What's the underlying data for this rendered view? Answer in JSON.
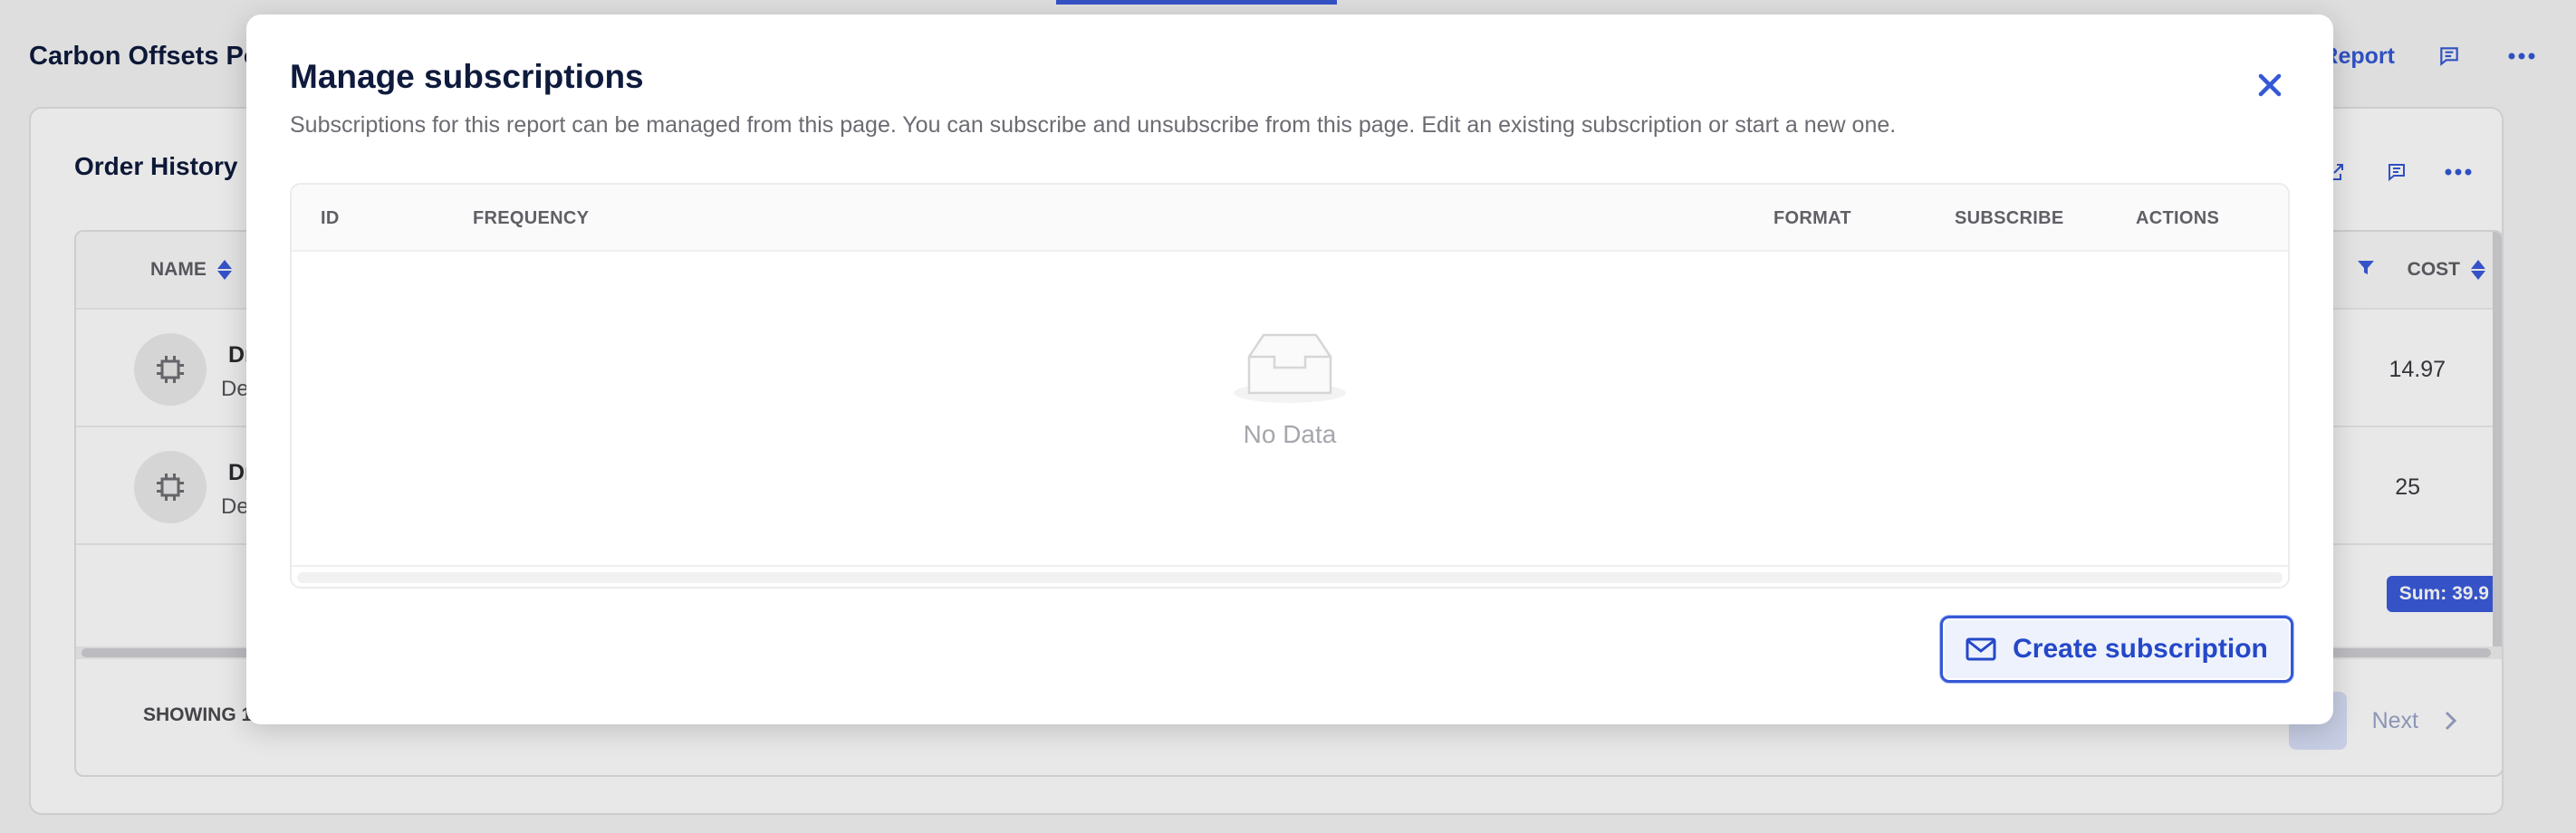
{
  "page": {
    "title": "Carbon Offsets Po",
    "header_link_label": "d Report",
    "card_title": "Order History",
    "columns": {
      "name": "NAME",
      "cost": "COST"
    },
    "rows": [
      {
        "name": "Dr",
        "desc": "De",
        "cost": "14.97"
      },
      {
        "name": "Dr",
        "desc": "De",
        "cost": "25"
      }
    ],
    "sum_badge": "Sum: 39.9",
    "showing": "SHOWING 1",
    "pager": {
      "next": "Next"
    }
  },
  "modal": {
    "title": "Manage subscriptions",
    "description": "Subscriptions for this report can be managed from this page. You can subscribe and unsubscribe from this page. Edit an existing subscription or start a new one.",
    "table": {
      "headers": {
        "id": "ID",
        "frequency": "FREQUENCY",
        "format": "FORMAT",
        "subscribe": "SUBSCRIBE",
        "actions": "ACTIONS"
      },
      "empty_text": "No Data"
    },
    "create_button": "Create subscription"
  },
  "colors": {
    "accent": "#3458d6",
    "title": "#0f1b3d"
  }
}
